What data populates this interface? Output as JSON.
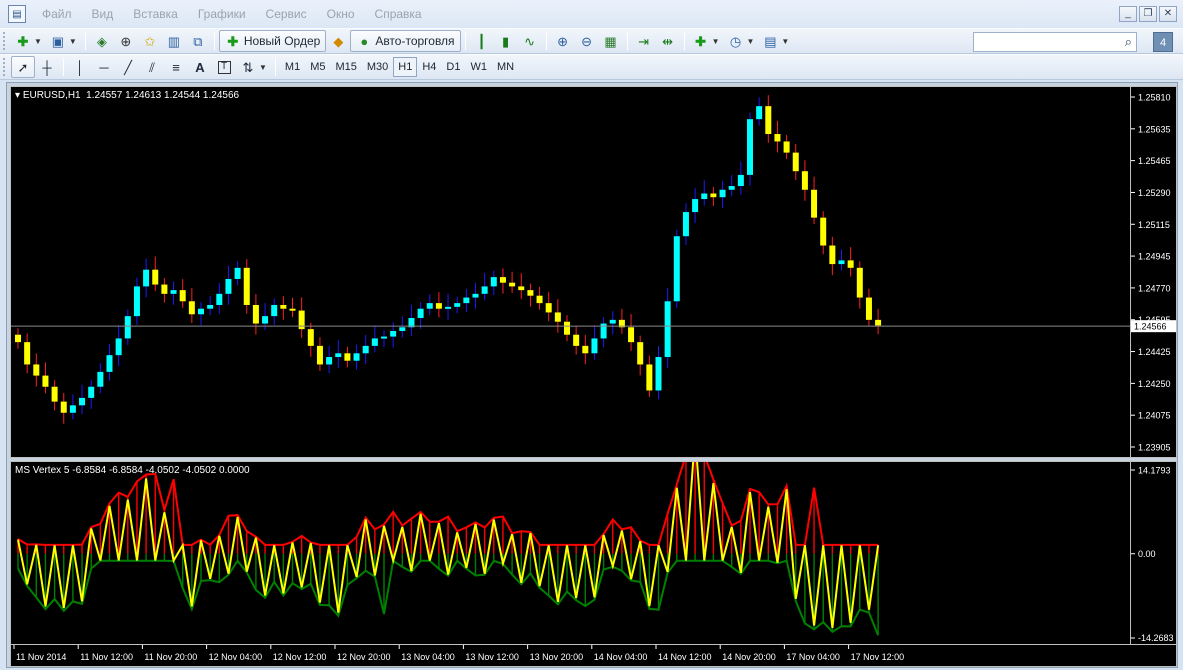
{
  "menu": [
    "Файл",
    "Вид",
    "Вставка",
    "Графики",
    "Сервис",
    "Окно",
    "Справка"
  ],
  "window_controls": [
    "_",
    "❐",
    "✕"
  ],
  "toolbar1": {
    "new_order_label": "Новый Ордер",
    "autotrading_label": "Авто-торговля",
    "notif_count": "4"
  },
  "timeframes": [
    "M1",
    "M5",
    "M15",
    "M30",
    "H1",
    "H4",
    "D1",
    "W1",
    "MN"
  ],
  "active_timeframe": "H1",
  "chart": {
    "symbol_label": "EURUSD,H1  1.24557 1.24613 1.24544 1.24566",
    "price_ticks": [
      "1.25810",
      "1.25635",
      "1.25465",
      "1.25290",
      "1.25115",
      "1.24945",
      "1.24770",
      "1.24595",
      "1.24425",
      "1.24250",
      "1.24075",
      "1.23905"
    ],
    "current_price": "1.24566",
    "colors": {
      "up": "#00ffff",
      "down": "#ffff00",
      "wick_up": "#1a1aff",
      "wick_down": "#ff2020",
      "background": "#000000"
    }
  },
  "indicator": {
    "label": "MS Vertex 5 -6.8584 -6.8584 -4.0502 -4.0502 0.0000",
    "ticks": [
      "14.1793",
      "0.00",
      "-14.2683"
    ],
    "colors": {
      "red": "#ff0000",
      "green": "#008000",
      "yellow": "#ffff00"
    }
  },
  "time_labels": [
    "11 Nov 2014",
    "11 Nov 12:00",
    "11 Nov 20:00",
    "12 Nov 04:00",
    "12 Nov 12:00",
    "12 Nov 20:00",
    "13 Nov 04:00",
    "13 Nov 12:00",
    "13 Nov 20:00",
    "14 Nov 04:00",
    "14 Nov 12:00",
    "14 Nov 20:00",
    "17 Nov 04:00",
    "17 Nov 12:00"
  ],
  "chart_data": {
    "type": "candlestick",
    "price_range": [
      1.23905,
      1.2581
    ],
    "closes": [
      1.2448,
      1.2436,
      1.243,
      1.2424,
      1.2416,
      1.241,
      1.2414,
      1.2418,
      1.2424,
      1.2432,
      1.2441,
      1.245,
      1.2462,
      1.2478,
      1.2487,
      1.2479,
      1.2474,
      1.2476,
      1.247,
      1.2463,
      1.2466,
      1.2468,
      1.2474,
      1.2482,
      1.2488,
      1.2468,
      1.2458,
      1.2462,
      1.2468,
      1.2466,
      1.2465,
      1.2455,
      1.2446,
      1.2436,
      1.244,
      1.2442,
      1.2438,
      1.2442,
      1.2446,
      1.245,
      1.2451,
      1.2454,
      1.2456,
      1.2461,
      1.2466,
      1.2469,
      1.2466,
      1.2467,
      1.2469,
      1.2472,
      1.2474,
      1.2478,
      1.2483,
      1.248,
      1.2478,
      1.2476,
      1.2473,
      1.2469,
      1.2464,
      1.2459,
      1.2452,
      1.2446,
      1.2442,
      1.245,
      1.2458,
      1.246,
      1.2456,
      1.2448,
      1.2436,
      1.2422,
      1.244,
      1.247,
      1.2505,
      1.2518,
      1.2525,
      1.2528,
      1.2526,
      1.253,
      1.2532,
      1.2538,
      1.2568,
      1.2575,
      1.256,
      1.2556,
      1.255,
      1.254,
      1.253,
      1.2515,
      1.25,
      1.249,
      1.2492,
      1.2488,
      1.2472,
      1.246,
      1.2457
    ],
    "indicator_range": [
      -14.2683,
      14.1793
    ]
  }
}
